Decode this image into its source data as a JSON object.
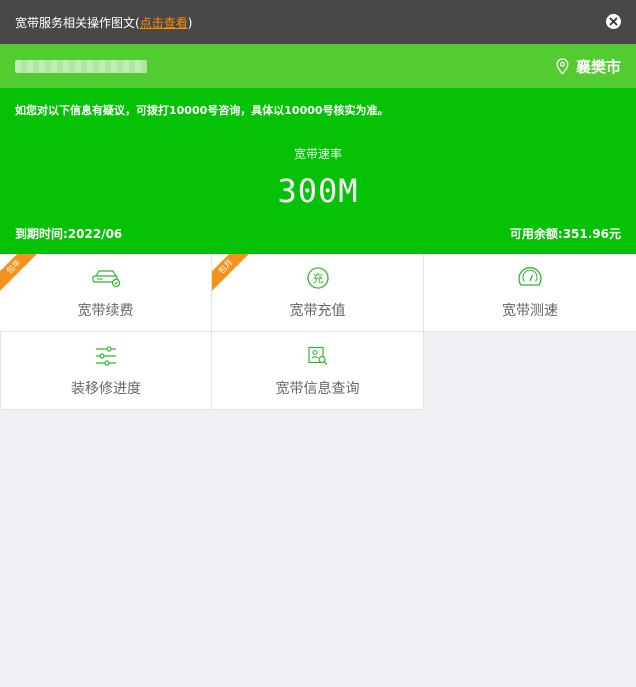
{
  "notice": {
    "text": "宽带服务相关操作图文",
    "paren_open": "(",
    "link_label": "点击查看",
    "paren_close": ")"
  },
  "account": {
    "city": "襄樊市"
  },
  "info": {
    "tip": "如您对以下信息有疑议，可拨打10000号咨询，具体以10000号核实为准。",
    "rate_label": "宽带速率",
    "rate_value": "300M",
    "expiry": "到期时间:2022/06",
    "balance": "可用余额:351.96元"
  },
  "grid": {
    "items": [
      {
        "label": "宽带续费",
        "icon": "router-icon",
        "badge": "包年"
      },
      {
        "label": "宽带充值",
        "icon": "recharge-icon",
        "badge": "包月"
      },
      {
        "label": "宽带测速",
        "icon": "speedometer-icon"
      },
      {
        "label": "装移修进度",
        "icon": "sliders-icon"
      },
      {
        "label": "宽带信息查询",
        "icon": "search-document-icon"
      }
    ]
  },
  "colors": {
    "notice_bg": "#484848",
    "account_bg": "#52cc30",
    "info_bg": "#06c206",
    "link": "#ff8a00",
    "ribbon": "#f5921e",
    "icon_green": "#2eb82e"
  }
}
